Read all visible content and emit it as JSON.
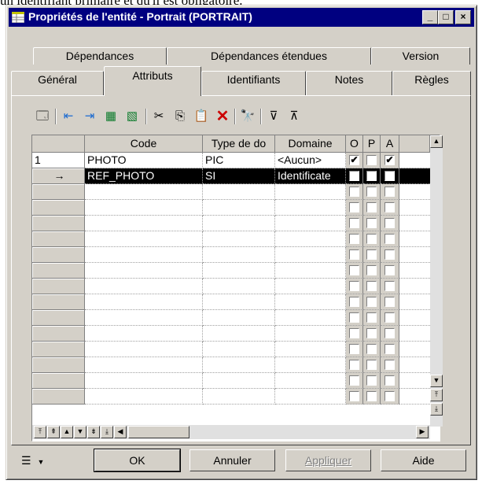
{
  "doc_text": "un identifiant primaire et qu'il est obligatoire.",
  "window": {
    "title": "Propriétés de l'entité - Portrait (PORTRAIT)",
    "controls": {
      "minimize": "_",
      "maximize": "□",
      "close": "×"
    }
  },
  "tabs_back": [
    "Dépendances",
    "Dépendances étendues",
    "Version"
  ],
  "tabs_front": [
    "Général",
    "Attributs",
    "Identifiants",
    "Notes",
    "Règles"
  ],
  "active_tab": "Attributs",
  "toolbar": {
    "icons": [
      "properties-icon",
      "add-row-icon",
      "insert-row-icon",
      "add-attributes-icon",
      "replicate-icon",
      "cut-icon",
      "copy-icon",
      "paste-icon",
      "delete-icon",
      "find-icon",
      "filter-icon",
      "filter-clear-icon"
    ],
    "glyphs": [
      "🗔",
      "⇤",
      "⇥",
      "▦",
      "▧",
      "✂",
      "⎘",
      "📋",
      "✕",
      "🔭",
      "⊽",
      "⊼"
    ]
  },
  "grid": {
    "columns": [
      "Code",
      "Type de do",
      "Domaine",
      "O",
      "P",
      "A"
    ],
    "rows": [
      {
        "num": "1",
        "code": "PHOTO",
        "type": "PIC",
        "domain": "<Aucun>",
        "O": true,
        "P": false,
        "A": true,
        "selected": false
      },
      {
        "num": "→",
        "code": "REF_PHOTO",
        "type": "SI",
        "domain": "Identificate",
        "O": true,
        "P": true,
        "A": true,
        "selected": true
      }
    ],
    "empty_rows": 14,
    "checkmark": "✔"
  },
  "nav_buttons": [
    "⤒",
    "⇞",
    "▲",
    "▼",
    "⇟",
    "⤓",
    "◀"
  ],
  "scroll_glyphs": {
    "up": "▲",
    "down": "▼",
    "top": "⤒",
    "bottom": "⤓",
    "right": "▶"
  },
  "footer": {
    "menu_icon": "☰",
    "menu_arrow": "▼",
    "ok": "OK",
    "cancel": "Annuler",
    "apply": "Appliquer",
    "help": "Aide"
  }
}
